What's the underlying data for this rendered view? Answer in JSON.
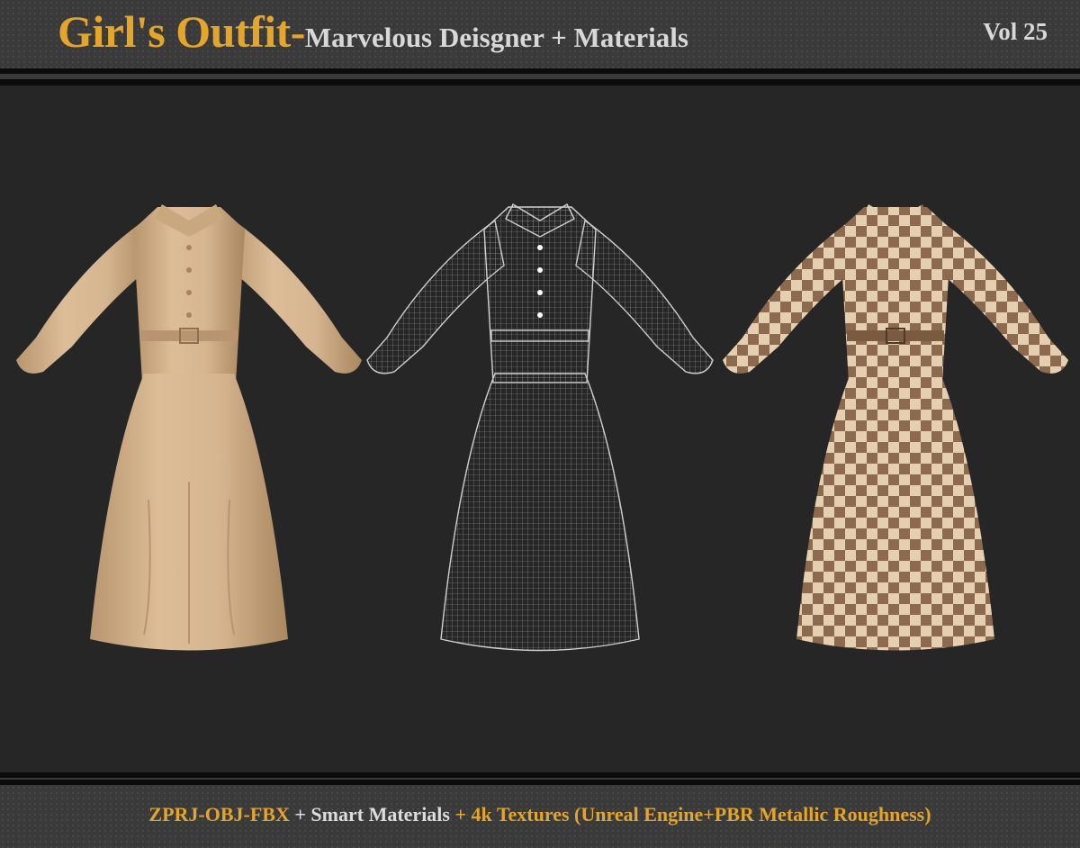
{
  "header": {
    "title_main": "Girl's Outfit-",
    "title_sub": "Marvelous Deisgner + Materials",
    "volume": "Vol 25"
  },
  "footer": {
    "parts": [
      {
        "text": "ZPRJ-OBJ-FBX",
        "style": "gold"
      },
      {
        "text": " + ",
        "style": "white"
      },
      {
        "text": "Smart Materials",
        "style": "white"
      },
      {
        "text": " + ",
        "style": "gold"
      },
      {
        "text": "4k Textures (Unreal Engine+PBR Metallic Roughness)",
        "style": "gold"
      }
    ]
  },
  "colors": {
    "accent_gold": "#e3a52a",
    "text_light": "#d8d8d8",
    "background": "#262626",
    "bar": "#3a3a3a",
    "beige_fabric": "#d4b48e",
    "wire_lines": "#bdbdbd",
    "check_light": "#e6cfb0",
    "check_dark": "#8c6a4e"
  },
  "views": [
    {
      "id": "solid",
      "material": "beige-solid"
    },
    {
      "id": "wireframe",
      "material": "wireframe"
    },
    {
      "id": "checker",
      "material": "checkered"
    }
  ]
}
